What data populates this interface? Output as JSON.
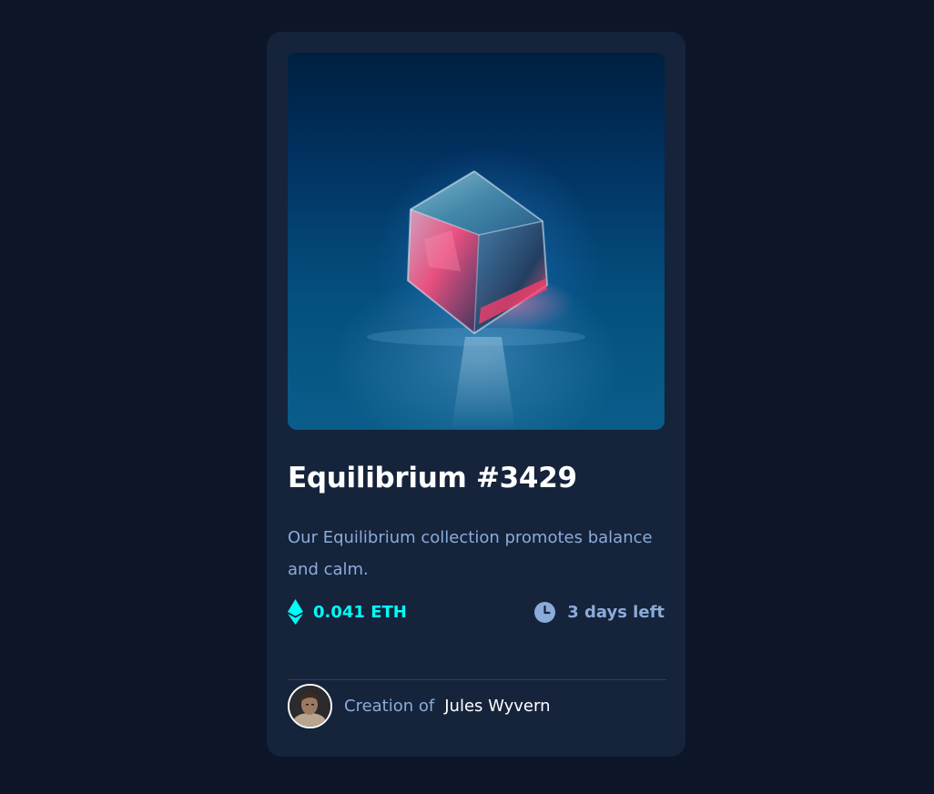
{
  "nft": {
    "image_alt": "glowing glass cube",
    "title": "Equilibrium #3429",
    "description": "Our Equilibrium collection promotes balance and calm.",
    "price": "0.041 ETH",
    "price_icon": "ethereum-icon",
    "time_left": "3 days left",
    "time_icon": "clock-icon"
  },
  "creator": {
    "prefix": "Creation of",
    "name": "Jules Wyvern",
    "avatar_icon": "avatar"
  },
  "colors": {
    "page_bg": "#0d1629",
    "card_bg": "#15233b",
    "accent_cyan": "#00fff8",
    "soft_blue": "#8bacd9",
    "divider": "#2e405a",
    "white": "#ffffff"
  }
}
